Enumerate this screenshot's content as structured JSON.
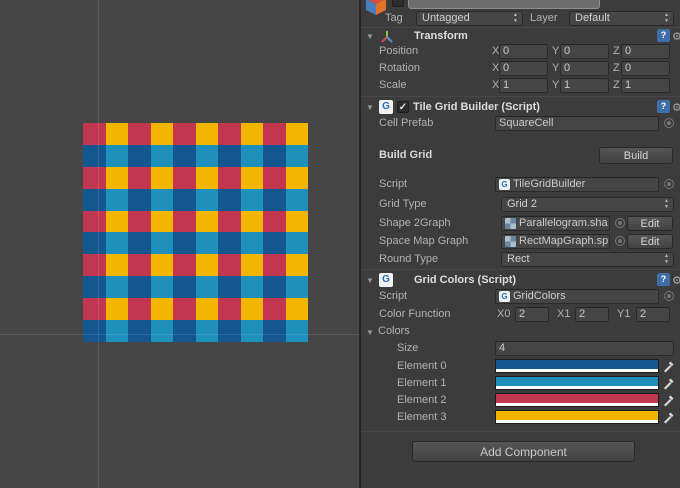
{
  "scene": {
    "palette": {
      "d": "#14578f",
      "l": "#1f8fbc",
      "r": "#c23650",
      "y": "#f2b600"
    },
    "rows": [
      "ryryryryry",
      "dldldldldl",
      "ryryryryry",
      "dldldldldl",
      "ryryryryry",
      "dldldldldl",
      "ryryryryry",
      "dldldldldl",
      "ryryryryry",
      "dldldldldl"
    ]
  },
  "inspector": {
    "header": {
      "tag_label": "Tag",
      "tag_value": "Untagged",
      "layer_label": "Layer",
      "layer_value": "Default"
    },
    "transform": {
      "title": "Transform",
      "axis": {
        "x": "X",
        "y": "Y",
        "z": "Z"
      },
      "rows": [
        {
          "label": "Position",
          "x": "0",
          "y": "0",
          "z": "0"
        },
        {
          "label": "Rotation",
          "x": "0",
          "y": "0",
          "z": "0"
        },
        {
          "label": "Scale",
          "x": "1",
          "y": "1",
          "z": "1"
        }
      ]
    },
    "tile_grid_builder": {
      "title": "Tile Grid Builder (Script)",
      "icon_letter": "G",
      "cell_prefab_label": "Cell Prefab",
      "cell_prefab_value": "SquareCell",
      "build_grid_label": "Build Grid",
      "build_button": "Build",
      "script_label": "Script",
      "script_value": "TileGridBuilder",
      "grid_type_label": "Grid Type",
      "grid_type_value": "Grid 2",
      "shape_label": "Shape 2Graph",
      "shape_value": "Parallelogram.sha",
      "shape_edit_button": "Edit",
      "space_map_label": "Space Map Graph",
      "space_map_value": "RectMapGraph.sp",
      "space_map_edit_button": "Edit",
      "round_type_label": "Round Type",
      "round_type_value": "Rect"
    },
    "grid_colors": {
      "title": "Grid Colors (Script)",
      "icon_letter": "G",
      "script_label": "Script",
      "script_value": "GridColors",
      "color_function_label": "Color Function",
      "x0_label": "X0",
      "x0_value": "2",
      "x1_label": "X1",
      "x1_value": "2",
      "y1_label": "Y1",
      "y1_value": "2",
      "colors_label": "Colors",
      "size_label": "Size",
      "size_value": "4",
      "elements": [
        {
          "label": "Element 0",
          "color": "#14578f"
        },
        {
          "label": "Element 1",
          "color": "#1f8fbc"
        },
        {
          "label": "Element 2",
          "color": "#c23650"
        },
        {
          "label": "Element 3",
          "color": "#f2b600"
        }
      ]
    },
    "add_component_button": "Add Component"
  }
}
